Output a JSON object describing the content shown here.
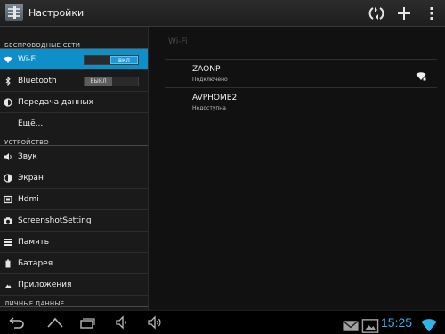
{
  "actionbar": {
    "title": "Настройки",
    "app_icon": "settings-icon",
    "actions": [
      "data-usage-icon",
      "add-icon",
      "overflow-menu-icon"
    ]
  },
  "left_pane": {
    "sections": [
      {
        "title": "БЕСПРОВОДНЫЕ СЕТИ"
      },
      {
        "title": "УСТРОЙСТВО"
      },
      {
        "title": "ЛИЧНЫЕ ДАННЫЕ"
      }
    ],
    "items": [
      {
        "label": "Wi-Fi",
        "icon": "wifi-icon",
        "toggle": "ВКЛ",
        "state": "on",
        "selected": true
      },
      {
        "label": "Bluetooth",
        "icon": "bluetooth-icon",
        "toggle": "ВЫКЛ",
        "state": "off"
      },
      {
        "label": "Передача данных",
        "icon": "data-usage-icon"
      },
      {
        "label": "Ещё..."
      },
      {
        "label": "Звук",
        "icon": "speaker-icon"
      },
      {
        "label": "Экран",
        "icon": "brightness-icon"
      },
      {
        "label": "Hdmi",
        "icon": "hdmi-icon"
      },
      {
        "label": "ScreenshotSetting",
        "icon": "camera-icon"
      },
      {
        "label": "Память",
        "icon": "storage-icon"
      },
      {
        "label": "Батарея",
        "icon": "battery-icon"
      },
      {
        "label": "Приложения",
        "icon": "apps-icon"
      }
    ]
  },
  "right_pane": {
    "header": "Wi-Fi",
    "networks": [
      {
        "ssid": "ZAONP",
        "status": "Подключено",
        "signal_icon": "wifi-signal-icon"
      },
      {
        "ssid": "AVPHOME2",
        "status": "Недоступна"
      }
    ]
  },
  "navbar": {
    "buttons": [
      "back-icon",
      "home-icon",
      "recent-apps-icon",
      "volume-down-icon",
      "volume-up-icon"
    ],
    "notifications": [
      "email-icon",
      "gallery-icon"
    ],
    "clock": "15:25",
    "status_icons": [
      "wifi-status-icon"
    ]
  },
  "colors": {
    "accent": "#0f8fc9",
    "clock": "#2fb3ea",
    "background": "#000000"
  }
}
